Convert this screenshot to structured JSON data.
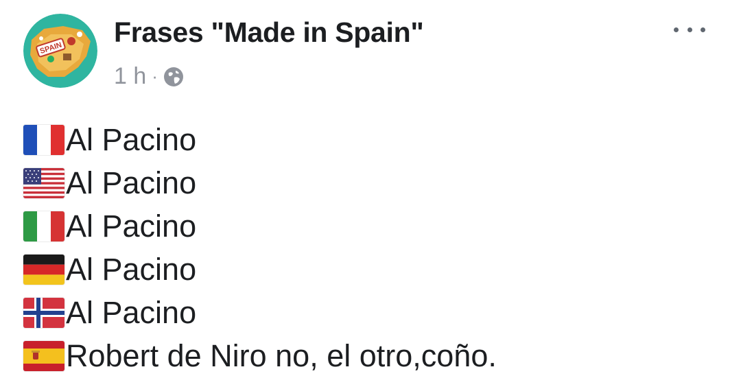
{
  "post": {
    "page_name": "Frases \"Made in Spain\"",
    "timestamp": "1 h",
    "separator": "·",
    "privacy_icon": "globe-icon",
    "menu_icon": "more-options-icon",
    "avatar_badge_text": "SPAIN"
  },
  "lines": [
    {
      "flag": "france-flag-icon",
      "text": "Al Pacino"
    },
    {
      "flag": "usa-flag-icon",
      "text": "Al Pacino"
    },
    {
      "flag": "italy-flag-icon",
      "text": "Al Pacino"
    },
    {
      "flag": "germany-flag-icon",
      "text": "Al Pacino"
    },
    {
      "flag": "norway-flag-icon",
      "text": "Al Pacino"
    },
    {
      "flag": "spain-flag-icon",
      "text": "Robert de Niro no, el otro,coño."
    }
  ],
  "colors": {
    "text": "#1c1e21",
    "meta": "#90949c",
    "avatar_bg": "#2fb5a0",
    "avatar_map": "#e8a93c"
  }
}
